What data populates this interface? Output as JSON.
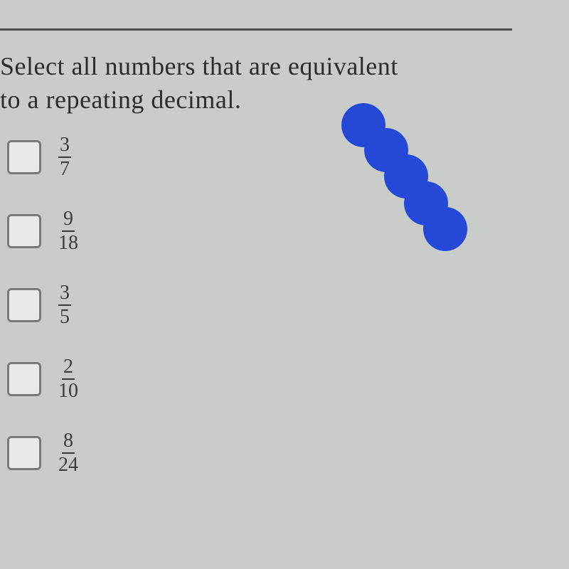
{
  "question": {
    "line1": "Select all numbers that are equivalent",
    "line2": "to a repeating decimal."
  },
  "options": [
    {
      "numerator": "3",
      "denominator": "7"
    },
    {
      "numerator": "9",
      "denominator": "18"
    },
    {
      "numerator": "3",
      "denominator": "5"
    },
    {
      "numerator": "2",
      "denominator": "10"
    },
    {
      "numerator": "8",
      "denominator": "24"
    }
  ]
}
